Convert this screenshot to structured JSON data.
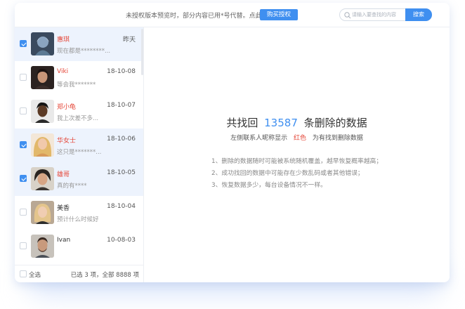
{
  "topbar": {
    "notice": "未授权版本预览时，部分内容已用*号代替。点此",
    "buy_label": "购买授权",
    "search_placeholder": "请输入要查找的内容",
    "search_label": "搜索"
  },
  "contacts": [
    {
      "name": "惠琪",
      "date": "昨天",
      "preview": "现在都是********...",
      "checked": true,
      "selected": true,
      "name_red": true
    },
    {
      "name": "Viki",
      "date": "18-10-08",
      "preview": "等会我*******",
      "checked": false,
      "selected": false,
      "name_red": true
    },
    {
      "name": "郑小龟",
      "date": "18-10-07",
      "preview": "我上次差不多...",
      "checked": false,
      "selected": false,
      "name_red": true
    },
    {
      "name": "华女士",
      "date": "18-10-06",
      "preview": "这只是*******...",
      "checked": true,
      "selected": true,
      "name_red": true
    },
    {
      "name": "雄哥",
      "date": "18-10-05",
      "preview": "真的有****",
      "checked": true,
      "selected": true,
      "name_red": true
    },
    {
      "name": "美香",
      "date": "18-10-04",
      "preview": "预计什么时候好",
      "checked": false,
      "selected": false,
      "name_red": false
    },
    {
      "name": "Ivan",
      "date": "10-08-03",
      "preview": "",
      "checked": false,
      "selected": false,
      "name_red": false
    }
  ],
  "footer": {
    "select_all": "全选",
    "count_text": "已选 3 项，全部 8888 项"
  },
  "main": {
    "headline_pre": "共找回",
    "headline_num": "13587",
    "headline_post": "条删除的数据",
    "sub_pre": "左侧联系人昵称显示",
    "sub_red": "红色",
    "sub_post": "为有找到删除数据",
    "notes": [
      "1、删除的数据随时可能被系统随机覆盖，越早恢复概率越高；",
      "2、成功找回的数据中可能存在少数乱码或者其他错误；",
      "3、恢复数据多少，每台设备情况不一样。"
    ]
  },
  "colors": {
    "accent": "#3f8ff0",
    "highlight_red": "#e5483a",
    "selected_row": "#edf3fd"
  }
}
